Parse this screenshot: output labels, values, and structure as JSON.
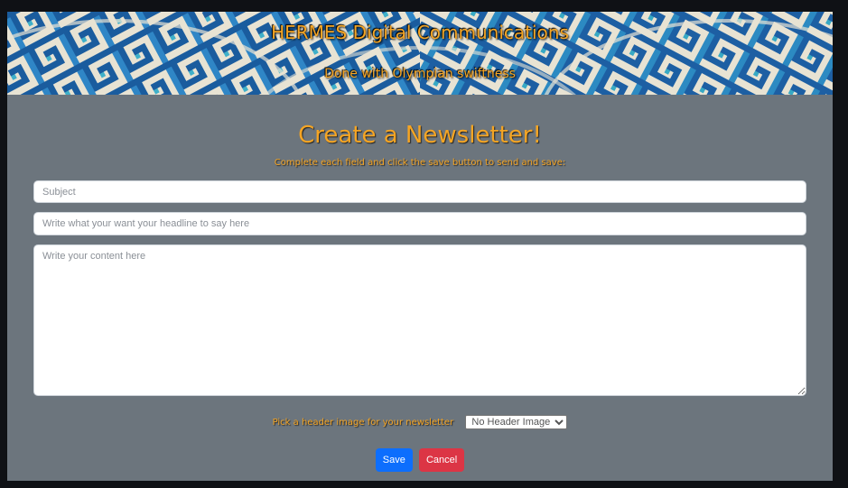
{
  "banner": {
    "title": "HERMES Digital Communications",
    "subtitle": "Done with Olympian swiftness"
  },
  "page": {
    "title": "Create a Newsletter!",
    "instructions": "Complete each field and click the save button to send and save:"
  },
  "form": {
    "subject_placeholder": "Subject",
    "subject_value": "",
    "headline_placeholder": "Write what your want your headline to say here",
    "headline_value": "",
    "content_placeholder": "Write your content here",
    "content_value": "",
    "header_image_label": "Pick a header image for your newsletter",
    "header_image_selected": "No Header Image",
    "save_label": "Save",
    "cancel_label": "Cancel"
  },
  "colors": {
    "accent": "#f5a524",
    "panel": "#6c757d",
    "save": "#0d6efd",
    "cancel": "#dc3545",
    "banner_blue": "#1a5c9e",
    "banner_cream": "#e8e3d3"
  }
}
